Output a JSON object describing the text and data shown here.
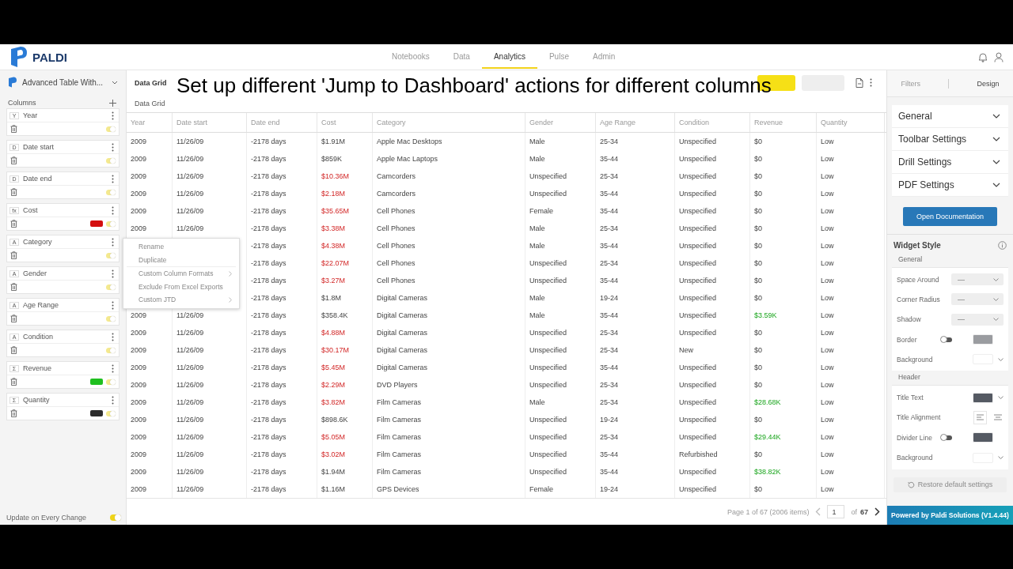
{
  "brand": {
    "name": "PALDI"
  },
  "nav": [
    {
      "label": "Notebooks",
      "selected": false
    },
    {
      "label": "Data",
      "selected": false
    },
    {
      "label": "Analytics",
      "selected": true
    },
    {
      "label": "Pulse",
      "selected": false
    },
    {
      "label": "Admin",
      "selected": false
    }
  ],
  "sidebar": {
    "widget_selector": "Advanced Table With...",
    "columns_heading": "Columns",
    "columns": [
      {
        "type_label": "Y",
        "name": "Year",
        "enabled": true
      },
      {
        "type_label": "D",
        "name": "Date start",
        "enabled": true
      },
      {
        "type_label": "D",
        "name": "Date end",
        "enabled": true
      },
      {
        "type_label": "fx",
        "name": "Cost",
        "enabled": true,
        "color": "#d40f0f"
      },
      {
        "type_label": "A",
        "name": "Category",
        "enabled": true
      },
      {
        "type_label": "A",
        "name": "Gender",
        "enabled": true
      },
      {
        "type_label": "A",
        "name": "Age Range",
        "enabled": true
      },
      {
        "type_label": "A",
        "name": "Condition",
        "enabled": true
      },
      {
        "type_label": "Σ",
        "name": "Revenue",
        "enabled": true,
        "color": "#1fbf1f"
      },
      {
        "type_label": "Σ",
        "name": "Quantity",
        "enabled": true,
        "color": "#2b2b2b"
      }
    ],
    "update_label": "Update on Every Change",
    "update_on": true
  },
  "widget": {
    "title": "Data Grid",
    "subtitle": "Data Grid",
    "caption": "Set up different 'Jump to Dashboard' actions for different columns",
    "table": {
      "columns": [
        "Year",
        "Date start",
        "Date end",
        "Cost",
        "Category",
        "Gender",
        "Age Range",
        "Condition",
        "Revenue",
        "Quantity"
      ],
      "rows": [
        {
          "year": "2009",
          "date_start": "11/26/09",
          "date_end": "-2178 days",
          "cost": "$1.91M",
          "cost_alert": false,
          "category": "Apple Mac Desktops",
          "gender": "Male",
          "age_range": "25-34",
          "condition": "Unspecified",
          "revenue": "$0",
          "revenue_alert": false,
          "quantity": "Low"
        },
        {
          "year": "2009",
          "date_start": "11/26/09",
          "date_end": "-2178 days",
          "cost": "$859K",
          "cost_alert": false,
          "category": "Apple Mac Laptops",
          "gender": "Male",
          "age_range": "35-44",
          "condition": "Unspecified",
          "revenue": "$0",
          "revenue_alert": false,
          "quantity": "Low"
        },
        {
          "year": "2009",
          "date_start": "11/26/09",
          "date_end": "-2178 days",
          "cost": "$10.36M",
          "cost_alert": true,
          "category": "Camcorders",
          "gender": "Unspecified",
          "age_range": "25-34",
          "condition": "Unspecified",
          "revenue": "$0",
          "revenue_alert": false,
          "quantity": "Low"
        },
        {
          "year": "2009",
          "date_start": "11/26/09",
          "date_end": "-2178 days",
          "cost": "$2.18M",
          "cost_alert": true,
          "category": "Camcorders",
          "gender": "Unspecified",
          "age_range": "35-44",
          "condition": "Unspecified",
          "revenue": "$0",
          "revenue_alert": false,
          "quantity": "Low"
        },
        {
          "year": "2009",
          "date_start": "11/26/09",
          "date_end": "-2178 days",
          "cost": "$35.65M",
          "cost_alert": true,
          "category": "Cell Phones",
          "gender": "Female",
          "age_range": "35-44",
          "condition": "Unspecified",
          "revenue": "$0",
          "revenue_alert": false,
          "quantity": "Low"
        },
        {
          "year": "2009",
          "date_start": "11/26/09",
          "date_end": "-2178 days",
          "cost": "$3.38M",
          "cost_alert": true,
          "category": "Cell Phones",
          "gender": "Male",
          "age_range": "25-34",
          "condition": "Unspecified",
          "revenue": "$0",
          "revenue_alert": false,
          "quantity": "Low"
        },
        {
          "date_end": "-2178 days",
          "cost": "$4.38M",
          "cost_alert": true,
          "category": "Cell Phones",
          "gender": "Male",
          "age_range": "35-44",
          "condition": "Unspecified",
          "revenue": "$0",
          "revenue_alert": false,
          "quantity": "Low"
        },
        {
          "date_end": "-2178 days",
          "cost": "$22.07M",
          "cost_alert": true,
          "category": "Cell Phones",
          "gender": "Unspecified",
          "age_range": "25-34",
          "condition": "Unspecified",
          "revenue": "$0",
          "revenue_alert": false,
          "quantity": "Low"
        },
        {
          "date_end": "-2178 days",
          "cost": "$3.27M",
          "cost_alert": true,
          "category": "Cell Phones",
          "gender": "Unspecified",
          "age_range": "35-44",
          "condition": "Unspecified",
          "revenue": "$0",
          "revenue_alert": false,
          "quantity": "Low"
        },
        {
          "date_end": "-2178 days",
          "cost": "$1.8M",
          "cost_alert": false,
          "category": "Digital Cameras",
          "gender": "Male",
          "age_range": "19-24",
          "condition": "Unspecified",
          "revenue": "$0",
          "revenue_alert": false,
          "quantity": "Low"
        },
        {
          "year": "2009",
          "date_start": "11/26/09",
          "date_end": "-2178 days",
          "cost": "$358.4K",
          "cost_alert": false,
          "category": "Digital Cameras",
          "gender": "Male",
          "age_range": "35-44",
          "condition": "Unspecified",
          "revenue": "$3.59K",
          "revenue_alert": true,
          "quantity": "Low"
        },
        {
          "year": "2009",
          "date_start": "11/26/09",
          "date_end": "-2178 days",
          "cost": "$4.88M",
          "cost_alert": true,
          "category": "Digital Cameras",
          "gender": "Unspecified",
          "age_range": "25-34",
          "condition": "Unspecified",
          "revenue": "$0",
          "revenue_alert": false,
          "quantity": "Low"
        },
        {
          "year": "2009",
          "date_start": "11/26/09",
          "date_end": "-2178 days",
          "cost": "$30.17M",
          "cost_alert": true,
          "category": "Digital Cameras",
          "gender": "Unspecified",
          "age_range": "25-34",
          "condition": "New",
          "revenue": "$0",
          "revenue_alert": false,
          "quantity": "Low"
        },
        {
          "year": "2009",
          "date_start": "11/26/09",
          "date_end": "-2178 days",
          "cost": "$5.45M",
          "cost_alert": true,
          "category": "Digital Cameras",
          "gender": "Unspecified",
          "age_range": "35-44",
          "condition": "Unspecified",
          "revenue": "$0",
          "revenue_alert": false,
          "quantity": "Low"
        },
        {
          "year": "2009",
          "date_start": "11/26/09",
          "date_end": "-2178 days",
          "cost": "$2.29M",
          "cost_alert": true,
          "category": "DVD Players",
          "gender": "Unspecified",
          "age_range": "25-34",
          "condition": "Unspecified",
          "revenue": "$0",
          "revenue_alert": false,
          "quantity": "Low"
        },
        {
          "year": "2009",
          "date_start": "11/26/09",
          "date_end": "-2178 days",
          "cost": "$3.82M",
          "cost_alert": true,
          "category": "Film Cameras",
          "gender": "Male",
          "age_range": "25-34",
          "condition": "Unspecified",
          "revenue": "$28.68K",
          "revenue_alert": true,
          "quantity": "Low"
        },
        {
          "year": "2009",
          "date_start": "11/26/09",
          "date_end": "-2178 days",
          "cost": "$898.6K",
          "cost_alert": false,
          "category": "Film Cameras",
          "gender": "Unspecified",
          "age_range": "19-24",
          "condition": "Unspecified",
          "revenue": "$0",
          "revenue_alert": false,
          "quantity": "Low"
        },
        {
          "year": "2009",
          "date_start": "11/26/09",
          "date_end": "-2178 days",
          "cost": "$5.05M",
          "cost_alert": true,
          "category": "Film Cameras",
          "gender": "Unspecified",
          "age_range": "25-34",
          "condition": "Unspecified",
          "revenue": "$29.44K",
          "revenue_alert": true,
          "quantity": "Low"
        },
        {
          "year": "2009",
          "date_start": "11/26/09",
          "date_end": "-2178 days",
          "cost": "$3.02M",
          "cost_alert": true,
          "category": "Film Cameras",
          "gender": "Unspecified",
          "age_range": "35-44",
          "condition": "Refurbished",
          "revenue": "$0",
          "revenue_alert": false,
          "quantity": "Low"
        },
        {
          "year": "2009",
          "date_start": "11/26/09",
          "date_end": "-2178 days",
          "cost": "$1.94M",
          "cost_alert": false,
          "category": "Film Cameras",
          "gender": "Unspecified",
          "age_range": "35-44",
          "condition": "Unspecified",
          "revenue": "$38.82K",
          "revenue_alert": true,
          "quantity": "Low"
        },
        {
          "year": "2009",
          "date_start": "11/26/09",
          "date_end": "-2178 days",
          "cost": "$1.16M",
          "cost_alert": false,
          "category": "GPS Devices",
          "gender": "Female",
          "age_range": "19-24",
          "condition": "Unspecified",
          "revenue": "$0",
          "revenue_alert": false,
          "quantity": "Low"
        }
      ]
    },
    "context_menu": [
      {
        "label": "Rename",
        "submenu": false
      },
      {
        "label": "Duplicate",
        "submenu": false
      },
      {
        "label": "Custom Column Formats",
        "submenu": true
      },
      {
        "label": "Exclude From Excel Exports",
        "submenu": false
      },
      {
        "label": "Custom JTD",
        "submenu": true
      }
    ],
    "pager": {
      "summary": "Page 1 of 67 (2006 items)",
      "page": "1",
      "of_label": "of",
      "total": "67"
    }
  },
  "design_panel": {
    "tabs": [
      {
        "label": "Filters",
        "selected": false
      },
      {
        "label": "Design",
        "selected": true
      }
    ],
    "sections": [
      {
        "label": "General",
        "expanded": false
      },
      {
        "label": "Toolbar Settings",
        "expanded": false
      },
      {
        "label": "Drill Settings",
        "expanded": false
      },
      {
        "label": "PDF Settings",
        "expanded": false
      }
    ],
    "doc_button": "Open Documentation",
    "widget_style": {
      "title": "Widget Style",
      "groups": [
        {
          "title": "General",
          "settings": [
            {
              "kind": "select",
              "label": "Space Around",
              "value": "—"
            },
            {
              "kind": "select",
              "label": "Corner Radius",
              "value": "—"
            },
            {
              "kind": "select",
              "label": "Shadow",
              "value": "—"
            },
            {
              "kind": "toggle_swatch",
              "label": "Border",
              "on": false,
              "color": "#9a9ca0"
            },
            {
              "kind": "swatch",
              "label": "Background",
              "color": "#ffffff"
            }
          ]
        },
        {
          "title": "Header",
          "settings": [
            {
              "kind": "swatch",
              "label": "Title Text",
              "color": "#555a63"
            },
            {
              "kind": "alignment",
              "label": "Title Alignment",
              "options": [
                {
                  "selected": true
                },
                {
                  "selected": false
                }
              ]
            },
            {
              "kind": "toggle_swatch",
              "label": "Divider Line",
              "on": false,
              "color": "#555a63"
            },
            {
              "kind": "swatch",
              "label": "Background",
              "color": "#ffffff"
            }
          ]
        }
      ],
      "restore_button": "Restore default settings",
      "restore_disabled": true
    },
    "footer": "Powered by Paldi Solutions (V1.4.44)"
  }
}
